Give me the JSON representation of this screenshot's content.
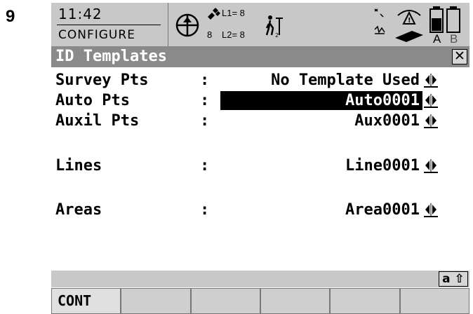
{
  "step_number": "9",
  "status": {
    "time": "11:42",
    "mode": "CONFIGURE",
    "gps": {
      "l1": "L1= 8",
      "l2": "L2= 8",
      "sats": "8"
    },
    "memory": {
      "a": "A",
      "b": "B"
    }
  },
  "title": "ID Templates",
  "rows": [
    {
      "label": "Survey Pts",
      "colon": ":",
      "value": "No Template Used"
    },
    {
      "label": "Auto Pts",
      "colon": ":",
      "value": "Auto0001"
    },
    {
      "label": "Auxil Pts",
      "colon": ":",
      "value": "Aux0001"
    },
    {
      "label": "Lines",
      "colon": ":",
      "value": "Line0001"
    },
    {
      "label": "Areas",
      "colon": ":",
      "value": "Area0001"
    }
  ],
  "input_mode": "a ⇧",
  "fkeys": [
    "CONT",
    "",
    "",
    "",
    "",
    ""
  ]
}
